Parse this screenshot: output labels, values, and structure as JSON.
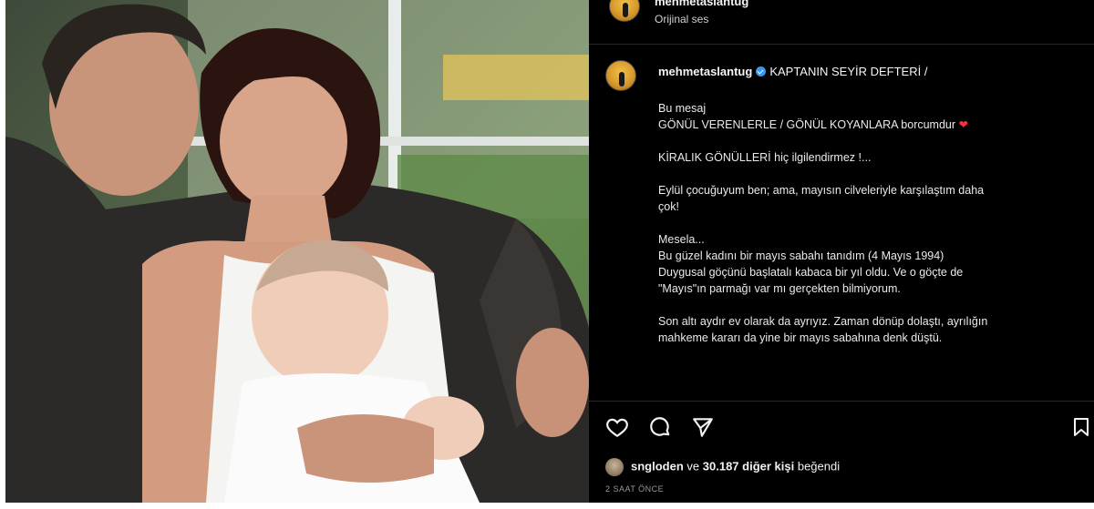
{
  "top_header": {
    "username": "mehmetaslantug",
    "audio": "Orijinal ses"
  },
  "caption": {
    "username": "mehmetaslantug",
    "title": "KAPTANIN SEYİR DEFTERİ /",
    "lines": [
      "Bu mesaj",
      "GÖNÜL VERENLERLE / GÖNÜL KOYANLARA borcumdur",
      "KİRALIK GÖNÜLLERİ hiç ilgilendirmez !...",
      "Eylül çocuğuyum ben; ama, mayısın cilveleriyle karşılaştım daha",
      "çok!",
      "Mesela...",
      "Bu güzel kadını bir mayıs sabahı tanıdım (4 Mayıs 1994)",
      "Duygusal göçünü başlatalı kabaca bir yıl oldu. Ve o göçte de",
      "\"Mayıs\"ın parmağı var mı gerçekten bilmiyorum.",
      "Son altı aydır ev olarak da ayrıyız. Zaman dönüp dolaştı, ayrılığın",
      "mahkeme kararı da yine bir mayıs sabahına denk düştü."
    ],
    "heart_icon": "red-heart-emoji"
  },
  "actions": {
    "icons": [
      "heart-icon",
      "comment-icon",
      "share-icon",
      "bookmark-icon"
    ]
  },
  "likes": {
    "liker": "sngloden",
    "connector": "ve",
    "count_text": "30.187 diğer kişi",
    "suffix": "beğendi"
  },
  "timestamp": "2 SAAT ÖNCE",
  "colors": {
    "background": "#000000",
    "text": "#f2f2f2",
    "verified": "#3897f0",
    "heart": "#ff2d3d"
  }
}
